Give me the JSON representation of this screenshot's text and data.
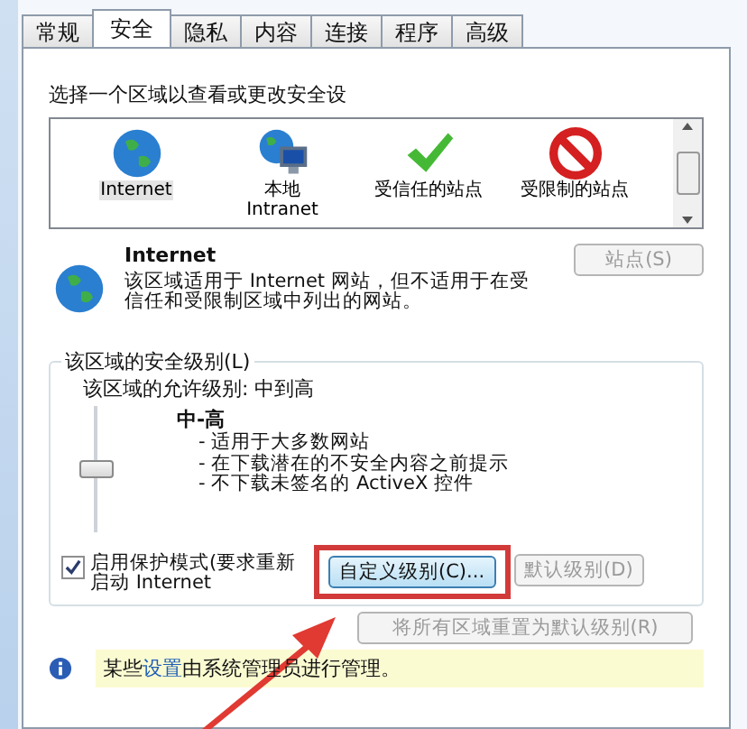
{
  "tabs": [
    {
      "label": "常规",
      "selected": false
    },
    {
      "label": "安全",
      "selected": true
    },
    {
      "label": "隐私",
      "selected": false
    },
    {
      "label": "内容",
      "selected": false
    },
    {
      "label": "连接",
      "selected": false
    },
    {
      "label": "程序",
      "selected": false
    },
    {
      "label": "高级",
      "selected": false
    }
  ],
  "zone_prompt": "选择一个区域以查看或更改安全设",
  "zones": [
    {
      "kind": "globe",
      "label_lines": [
        "Internet"
      ],
      "selected": true
    },
    {
      "kind": "intranet",
      "label_lines": [
        "本地",
        "Intranet"
      ],
      "selected": false
    },
    {
      "kind": "trusted",
      "label_lines": [
        "受信任的站点"
      ],
      "selected": false
    },
    {
      "kind": "restricted",
      "label_lines": [
        "受限制的站点"
      ],
      "selected": false
    }
  ],
  "zone_detail": {
    "title": "Internet",
    "description": "该区域适用于 Internet 网站，但不适用于在受信任和受限制区域中列出的网站。",
    "sites_button": {
      "label": "站点(S)",
      "disabled": true
    }
  },
  "security_level": {
    "legend": "该区域的安全级别(L)",
    "allowed": "该区域的允许级别: 中到高",
    "level": 0.5,
    "level_name": "中-高",
    "bullets": [
      "- 适用于大多数网站",
      "- 在下载潜在的不安全内容之前提示",
      "- 不下载未签名的 ActiveX 控件"
    ],
    "protected_mode": {
      "label": "启用保护模式(要求重新启动 Internet",
      "checked": true
    },
    "buttons": [
      {
        "label": "自定义级别(C)...",
        "disabled": false,
        "highlighted": true
      },
      {
        "label": "默认级别(D)",
        "disabled": true,
        "highlighted": false
      }
    ]
  },
  "reset_button": {
    "label": "将所有区域重置为默认级别(R)",
    "disabled": true
  },
  "info_bar": {
    "before": "某些",
    "link": "设置",
    "after": "由系统管理员进行管理。"
  },
  "annotation_arrow": true
}
